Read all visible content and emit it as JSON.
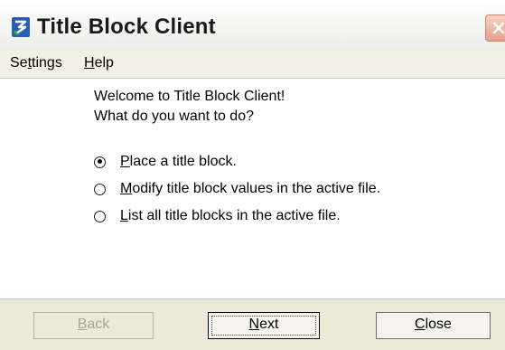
{
  "window": {
    "title": "Title Block Client"
  },
  "menu": {
    "settings_pre": "Se",
    "settings_ul": "t",
    "settings_post": "tings",
    "help_ul": "H",
    "help_post": "elp"
  },
  "content": {
    "welcome_line1": "Welcome to Title Block Client!",
    "welcome_line2": "What do you want to do?",
    "options": [
      {
        "ul": "P",
        "rest": "lace a title block.",
        "checked": true
      },
      {
        "ul": "M",
        "rest": "odify title block values in the active file.",
        "checked": false
      },
      {
        "ul": "L",
        "rest": "ist all title blocks in the active file.",
        "checked": false
      }
    ]
  },
  "buttons": {
    "back_ul": "B",
    "back_rest": "ack",
    "next_ul": "N",
    "next_rest": "ext",
    "close_ul": "C",
    "close_rest": "lose"
  },
  "colors": {
    "window_bg": "#ece9d8",
    "content_bg": "#ffffff",
    "disabled_text": "#a7a59b",
    "close_button": "#e6a08a"
  }
}
